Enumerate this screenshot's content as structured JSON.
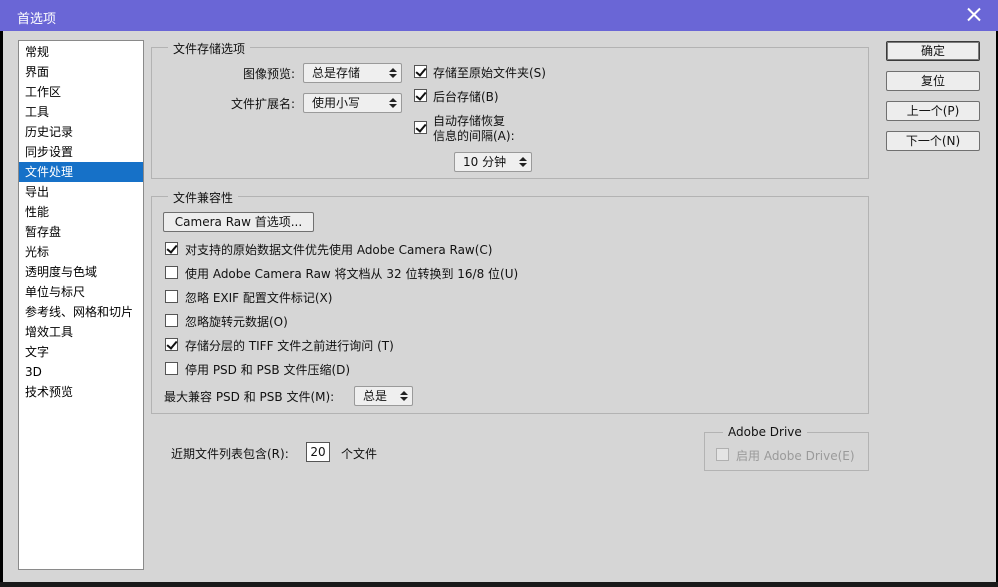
{
  "window": {
    "title": "首选项"
  },
  "sidebar": {
    "items": [
      {
        "label": "常规"
      },
      {
        "label": "界面"
      },
      {
        "label": "工作区"
      },
      {
        "label": "工具"
      },
      {
        "label": "历史记录"
      },
      {
        "label": "同步设置"
      },
      {
        "label": "文件处理",
        "selected": true
      },
      {
        "label": "导出"
      },
      {
        "label": "性能"
      },
      {
        "label": "暂存盘"
      },
      {
        "label": "光标"
      },
      {
        "label": "透明度与色域"
      },
      {
        "label": "单位与标尺"
      },
      {
        "label": "参考线、网格和切片"
      },
      {
        "label": "增效工具"
      },
      {
        "label": "文字"
      },
      {
        "label": "3D"
      },
      {
        "label": "技术预览"
      }
    ]
  },
  "file_save": {
    "group_title": "文件存储选项",
    "image_preview_label": "图像预览:",
    "image_preview_value": "总是存储",
    "extension_label": "文件扩展名:",
    "extension_value": "使用小写",
    "save_to_original_label": "存储至原始文件夹(S)",
    "save_to_original_checked": true,
    "background_save_label": "后台存储(B)",
    "background_save_checked": true,
    "auto_recover_label_1": "自动存储恢复",
    "auto_recover_label_2": "信息的间隔(A):",
    "auto_recover_checked": true,
    "interval_value": "10 分钟"
  },
  "compat": {
    "group_title": "文件兼容性",
    "camera_raw_button": "Camera Raw 首选项...",
    "options": [
      {
        "label": "对支持的原始数据文件优先使用 Adobe Camera Raw(C)",
        "checked": true
      },
      {
        "label": "使用 Adobe Camera Raw 将文档从 32 位转换到 16/8 位(U)",
        "checked": false
      },
      {
        "label": "忽略 EXIF 配置文件标记(X)",
        "checked": false
      },
      {
        "label": "忽略旋转元数据(O)",
        "checked": false
      },
      {
        "label": "存储分层的 TIFF 文件之前进行询问 (T)",
        "checked": true
      },
      {
        "label": "停用 PSD 和 PSB 文件压缩(D)",
        "checked": false
      }
    ],
    "max_compat_label": "最大兼容 PSD 和 PSB 文件(M):",
    "max_compat_value": "总是"
  },
  "recent": {
    "label": "近期文件列表包含(R):",
    "value": "20",
    "suffix": "个文件"
  },
  "adobe_drive": {
    "group_title": "Adobe Drive",
    "enable_label": "启用 Adobe Drive(E)",
    "enabled": false
  },
  "buttons": {
    "ok": "确定",
    "reset": "复位",
    "prev": "上一个(P)",
    "next": "下一个(N)"
  },
  "colors": {
    "titlebar": "#6a66d6",
    "selection": "#1671c8",
    "dialog_bg": "#d6d6d6"
  }
}
